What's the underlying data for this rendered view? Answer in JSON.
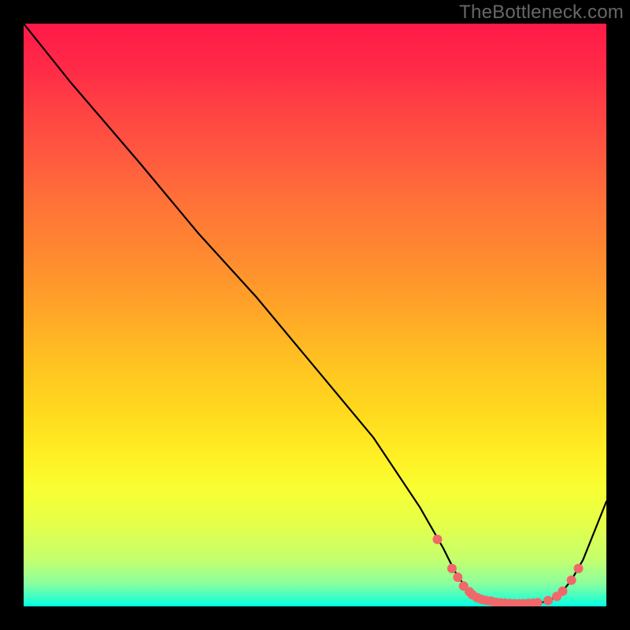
{
  "watermark": "TheBottleneck.com",
  "chart_data": {
    "type": "line",
    "title": "",
    "xlabel": "",
    "ylabel": "",
    "xlim": [
      0,
      100
    ],
    "ylim": [
      0,
      100
    ],
    "series": [
      {
        "name": "curve",
        "x": [
          0,
          8,
          20,
          30,
          40,
          50,
          60,
          68,
          72,
          74,
          76,
          78,
          80,
          82,
          84,
          86,
          88,
          90,
          92,
          94,
          96,
          100
        ],
        "y": [
          100,
          90,
          76,
          64,
          53,
          41,
          29,
          17,
          10,
          6,
          3,
          1.5,
          0.8,
          0.5,
          0.4,
          0.4,
          0.5,
          0.9,
          2.0,
          4.5,
          8,
          18
        ]
      }
    ],
    "markers": {
      "name": "highlight-points",
      "color": "#f0686a",
      "radius_px": 6,
      "x": [
        71,
        73.5,
        74.5,
        75.5,
        76.5,
        77,
        77.8,
        78.6,
        79.4,
        80.2,
        81,
        81.8,
        82.6,
        83.4,
        84.2,
        85,
        85.8,
        86.6,
        87.4,
        88.2,
        90,
        91.5,
        92.5,
        94,
        95.2
      ],
      "y": [
        11.5,
        6.5,
        5.0,
        3.5,
        2.5,
        2.0,
        1.5,
        1.2,
        1.0,
        0.9,
        0.7,
        0.6,
        0.55,
        0.5,
        0.45,
        0.45,
        0.45,
        0.5,
        0.55,
        0.65,
        1.0,
        1.7,
        2.6,
        4.5,
        6.5
      ]
    },
    "colors": {
      "line": "#000000",
      "marker": "#f0686a",
      "background_top": "#ff1a49",
      "background_bottom": "#00ffe4"
    }
  }
}
